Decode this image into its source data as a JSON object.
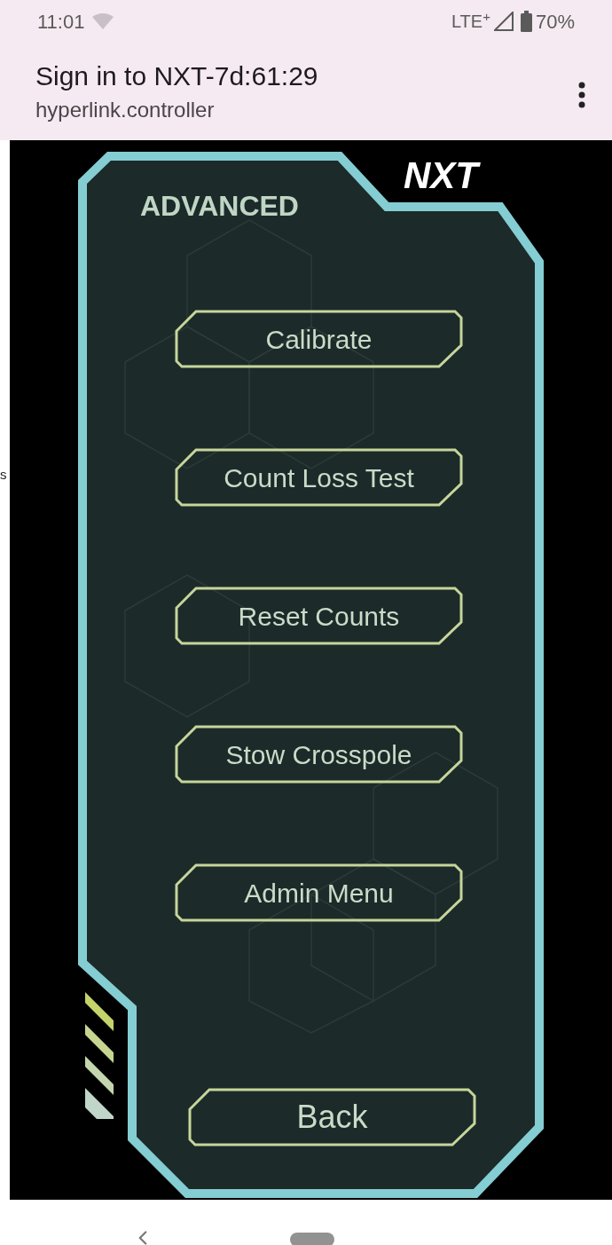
{
  "status_bar": {
    "time": "11:01",
    "network": "LTE$^{+}$",
    "battery": "70%"
  },
  "header": {
    "title": "Sign in to NXT-7d:61:29",
    "subtitle": "hyperlink.controller"
  },
  "edge_text": "s",
  "panel": {
    "logo": "NXT",
    "title": "ADVANCED",
    "buttons": [
      {
        "label": "Calibrate"
      },
      {
        "label": "Count Loss Test"
      },
      {
        "label": "Reset Counts"
      },
      {
        "label": "Stow Crosspole"
      },
      {
        "label": "Admin Menu"
      }
    ],
    "back_button": "Back"
  }
}
